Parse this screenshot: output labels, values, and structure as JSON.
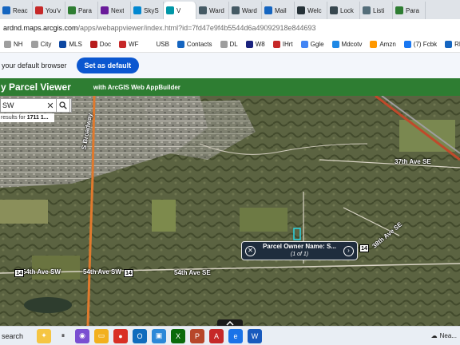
{
  "tabs": [
    {
      "label": "Reac",
      "color": "#1565c0"
    },
    {
      "label": "You'v",
      "color": "#c62828"
    },
    {
      "label": "Para",
      "color": "#2e7d32"
    },
    {
      "label": "Next",
      "color": "#6a1b9a"
    },
    {
      "label": "SkyS",
      "color": "#0288d1"
    },
    {
      "label": "V",
      "color": "#0097a7",
      "active": true
    },
    {
      "label": "Ward",
      "color": "#455a64"
    },
    {
      "label": "Ward",
      "color": "#455a64"
    },
    {
      "label": "Mail",
      "color": "#1565c0"
    },
    {
      "label": "Welc",
      "color": "#263238"
    },
    {
      "label": "Lock",
      "color": "#37474f"
    },
    {
      "label": "Listi",
      "color": "#546e7a"
    },
    {
      "label": "Para",
      "color": "#2e7d32"
    }
  ],
  "address": {
    "host": "ardnd.maps.arcgis.com",
    "path": "/apps/webappviewer/index.html?id=7fd47e9f4b5544d6a49092918e844693"
  },
  "bookmarks": [
    {
      "label": "NH",
      "color": "#9e9e9e"
    },
    {
      "label": "City",
      "color": "#9e9e9e"
    },
    {
      "label": "MLS",
      "color": "#0d47a1"
    },
    {
      "label": "Doc",
      "color": "#b71c1c"
    },
    {
      "label": "WF",
      "color": "#c62828"
    },
    {
      "label": "USB",
      "color": "#ffffff"
    },
    {
      "label": "Contacts",
      "color": "#1565c0"
    },
    {
      "label": "DL",
      "color": "#9e9e9e"
    },
    {
      "label": "W8",
      "color": "#1a237e"
    },
    {
      "label": "IHrt",
      "color": "#c62828"
    },
    {
      "label": "Ggle",
      "color": "#4285f4"
    },
    {
      "label": "Mdcotv",
      "color": "#1e88e5"
    },
    {
      "label": "Amzn",
      "color": "#ff9800"
    },
    {
      "label": "(7) Fcbk",
      "color": "#1877f2"
    },
    {
      "label": "RPR",
      "color": "#1565c0"
    }
  ],
  "banner": {
    "message": "your default browser",
    "button": "Set as default"
  },
  "app": {
    "title": "y Parcel Viewer",
    "subtitle": "with ArcGIS Web AppBuilder"
  },
  "search": {
    "value": "SW",
    "clear": "✕",
    "results_prefix": "results for",
    "results_value": "1711 1..."
  },
  "popup": {
    "title": "Parcel Owner Name: S...",
    "counter": "(1 of 1)"
  },
  "map_labels": {
    "ave54_left": "54th Ave SW",
    "ave54_mid": "54th Ave SW",
    "ave54_right": "54th Ave SE",
    "ave37": "37th Ave SE",
    "ave38": "38th Ave SE",
    "broadway": "S Broadway",
    "route": "14"
  },
  "taskbar": {
    "search": "search",
    "weather": "Nea..."
  }
}
